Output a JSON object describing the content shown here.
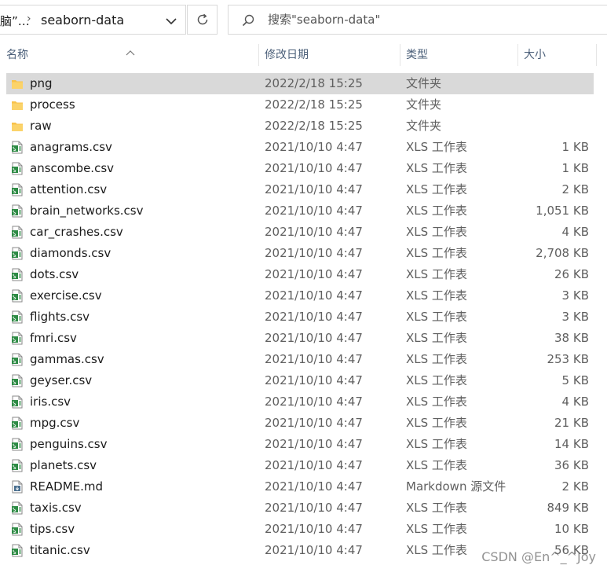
{
  "address": {
    "prev_crumb": "脑”…",
    "separator": "›",
    "current_folder": "seaborn-data"
  },
  "search": {
    "placeholder": "搜索\"seaborn-data\""
  },
  "columns": {
    "name": "名称",
    "date": "修改日期",
    "type": "类型",
    "size": "大小"
  },
  "colors": {
    "folder": "#f8c24a",
    "csv_icon": "#2e8b45",
    "selected_row": "#d9d9d9"
  },
  "files": [
    {
      "name": "png",
      "date": "2022/2/18 15:25",
      "type": "文件夹",
      "size": "",
      "icon": "folder-icon",
      "selected": true
    },
    {
      "name": "process",
      "date": "2022/2/18 15:25",
      "type": "文件夹",
      "size": "",
      "icon": "folder-icon"
    },
    {
      "name": "raw",
      "date": "2022/2/18 15:25",
      "type": "文件夹",
      "size": "",
      "icon": "folder-icon"
    },
    {
      "name": "anagrams.csv",
      "date": "2021/10/10 4:47",
      "type": "XLS 工作表",
      "size": "1 KB",
      "icon": "csv-file-icon"
    },
    {
      "name": "anscombe.csv",
      "date": "2021/10/10 4:47",
      "type": "XLS 工作表",
      "size": "1 KB",
      "icon": "csv-file-icon"
    },
    {
      "name": "attention.csv",
      "date": "2021/10/10 4:47",
      "type": "XLS 工作表",
      "size": "2 KB",
      "icon": "csv-file-icon"
    },
    {
      "name": "brain_networks.csv",
      "date": "2021/10/10 4:47",
      "type": "XLS 工作表",
      "size": "1,051 KB",
      "icon": "csv-file-icon"
    },
    {
      "name": "car_crashes.csv",
      "date": "2021/10/10 4:47",
      "type": "XLS 工作表",
      "size": "4 KB",
      "icon": "csv-file-icon"
    },
    {
      "name": "diamonds.csv",
      "date": "2021/10/10 4:47",
      "type": "XLS 工作表",
      "size": "2,708 KB",
      "icon": "csv-file-icon"
    },
    {
      "name": "dots.csv",
      "date": "2021/10/10 4:47",
      "type": "XLS 工作表",
      "size": "26 KB",
      "icon": "csv-file-icon"
    },
    {
      "name": "exercise.csv",
      "date": "2021/10/10 4:47",
      "type": "XLS 工作表",
      "size": "3 KB",
      "icon": "csv-file-icon"
    },
    {
      "name": "flights.csv",
      "date": "2021/10/10 4:47",
      "type": "XLS 工作表",
      "size": "3 KB",
      "icon": "csv-file-icon"
    },
    {
      "name": "fmri.csv",
      "date": "2021/10/10 4:47",
      "type": "XLS 工作表",
      "size": "38 KB",
      "icon": "csv-file-icon"
    },
    {
      "name": "gammas.csv",
      "date": "2021/10/10 4:47",
      "type": "XLS 工作表",
      "size": "253 KB",
      "icon": "csv-file-icon"
    },
    {
      "name": "geyser.csv",
      "date": "2021/10/10 4:47",
      "type": "XLS 工作表",
      "size": "5 KB",
      "icon": "csv-file-icon"
    },
    {
      "name": "iris.csv",
      "date": "2021/10/10 4:47",
      "type": "XLS 工作表",
      "size": "4 KB",
      "icon": "csv-file-icon"
    },
    {
      "name": "mpg.csv",
      "date": "2021/10/10 4:47",
      "type": "XLS 工作表",
      "size": "21 KB",
      "icon": "csv-file-icon"
    },
    {
      "name": "penguins.csv",
      "date": "2021/10/10 4:47",
      "type": "XLS 工作表",
      "size": "14 KB",
      "icon": "csv-file-icon"
    },
    {
      "name": "planets.csv",
      "date": "2021/10/10 4:47",
      "type": "XLS 工作表",
      "size": "36 KB",
      "icon": "csv-file-icon"
    },
    {
      "name": "README.md",
      "date": "2021/10/10 4:47",
      "type": "Markdown 源文件",
      "size": "2 KB",
      "icon": "markdown-file-icon"
    },
    {
      "name": "taxis.csv",
      "date": "2021/10/10 4:47",
      "type": "XLS 工作表",
      "size": "849 KB",
      "icon": "csv-file-icon"
    },
    {
      "name": "tips.csv",
      "date": "2021/10/10 4:47",
      "type": "XLS 工作表",
      "size": "10 KB",
      "icon": "csv-file-icon"
    },
    {
      "name": "titanic.csv",
      "date": "2021/10/10 4:47",
      "type": "XLS 工作表",
      "size": "56 KB",
      "icon": "csv-file-icon"
    }
  ],
  "watermark": "CSDN @En^_^Joy"
}
